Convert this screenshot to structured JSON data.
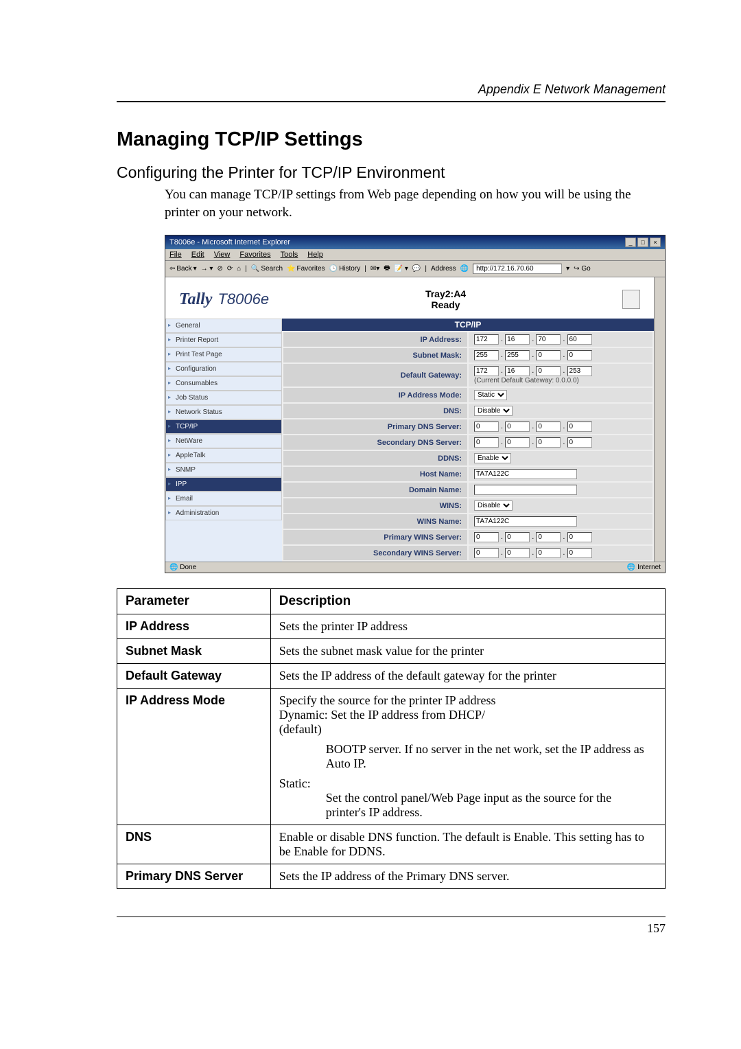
{
  "page": {
    "header": "Appendix E Network Management",
    "h1": "Managing TCP/IP Settings",
    "h2": "Configuring the Printer for TCP/IP Environment",
    "intro": "You can manage TCP/IP settings from Web page depending on how you will be using the printer on your network.",
    "footer_num": "157"
  },
  "browser": {
    "title": "T8006e - Microsoft Internet Explorer",
    "menu": {
      "file": "File",
      "edit": "Edit",
      "view": "View",
      "favorites": "Favorites",
      "tools": "Tools",
      "help": "Help"
    },
    "toolbar": {
      "back": "Back",
      "search": "Search",
      "favorites": "Favorites",
      "history": "History",
      "address_label": "Address",
      "address_value": "http://172.16.70.60",
      "go": "Go"
    },
    "brand": "Tally",
    "model": "T8006e",
    "status_line1": "Tray2:A4",
    "status_line2": "Ready",
    "section": "TCP/IP",
    "done": "Done",
    "zone": "Internet"
  },
  "sidebar": {
    "items": [
      {
        "label": "General"
      },
      {
        "label": "Printer Report"
      },
      {
        "label": "Print Test Page"
      },
      {
        "label": "Configuration"
      },
      {
        "label": "Consumables"
      },
      {
        "label": "Job Status"
      },
      {
        "label": "Network Status"
      },
      {
        "label": "TCP/IP"
      },
      {
        "label": "NetWare"
      },
      {
        "label": "AppleTalk"
      },
      {
        "label": "SNMP"
      },
      {
        "label": "IPP"
      },
      {
        "label": "Email"
      },
      {
        "label": "Administration"
      }
    ]
  },
  "form": {
    "ip_address": {
      "label": "IP Address:",
      "o1": "172",
      "o2": "16",
      "o3": "70",
      "o4": "60"
    },
    "subnet_mask": {
      "label": "Subnet Mask:",
      "o1": "255",
      "o2": "255",
      "o3": "0",
      "o4": "0"
    },
    "gateway": {
      "label": "Default Gateway:",
      "o1": "172",
      "o2": "16",
      "o3": "0",
      "o4": "253",
      "note": "(Current Default Gateway: 0.0.0.0)"
    },
    "ip_mode": {
      "label": "IP Address Mode:",
      "value": "Static"
    },
    "dns": {
      "label": "DNS:",
      "value": "Disable"
    },
    "pdns": {
      "label": "Primary DNS Server:",
      "o1": "0",
      "o2": "0",
      "o3": "0",
      "o4": "0"
    },
    "sdns": {
      "label": "Secondary DNS Server:",
      "o1": "0",
      "o2": "0",
      "o3": "0",
      "o4": "0"
    },
    "ddns": {
      "label": "DDNS:",
      "value": "Enable"
    },
    "host": {
      "label": "Host Name:",
      "value": "TA7A122C"
    },
    "domain": {
      "label": "Domain Name:",
      "value": ""
    },
    "wins": {
      "label": "WINS:",
      "value": "Disable"
    },
    "wins_name": {
      "label": "WINS Name:",
      "value": "TA7A122C"
    },
    "pwins": {
      "label": "Primary WINS Server:",
      "o1": "0",
      "o2": "0",
      "o3": "0",
      "o4": "0"
    },
    "swins": {
      "label": "Secondary WINS Server:",
      "o1": "0",
      "o2": "0",
      "o3": "0",
      "o4": "0"
    }
  },
  "table": {
    "headers": {
      "param": "Parameter",
      "desc": "Description"
    },
    "rows": {
      "ip": {
        "name": "IP Address",
        "desc": "Sets the printer IP address"
      },
      "subnet": {
        "name": "Subnet Mask",
        "desc": "Sets the subnet mask value for the printer"
      },
      "gateway": {
        "name": "Default Gateway",
        "desc": "Sets the IP address of the default gateway for the printer"
      },
      "mode": {
        "name": "IP Address Mode",
        "desc1": "Specify the source for the printer IP address",
        "desc2": "Dynamic:  Set the IP address from DHCP/",
        "desc3": "(default)",
        "bootp": "BOOTP server. If no server in the net work, set the IP address as Auto IP.",
        "static_lbl": "Static:",
        "static_desc": "Set the control panel/Web Page input as the source for the printer's IP address."
      },
      "dns": {
        "name": "DNS",
        "desc": "Enable or disable DNS function. The default is Enable. This setting has to be Enable for DDNS."
      },
      "pdns": {
        "name": "Primary DNS Server",
        "desc": "Sets the IP address of the Primary DNS server."
      }
    }
  }
}
